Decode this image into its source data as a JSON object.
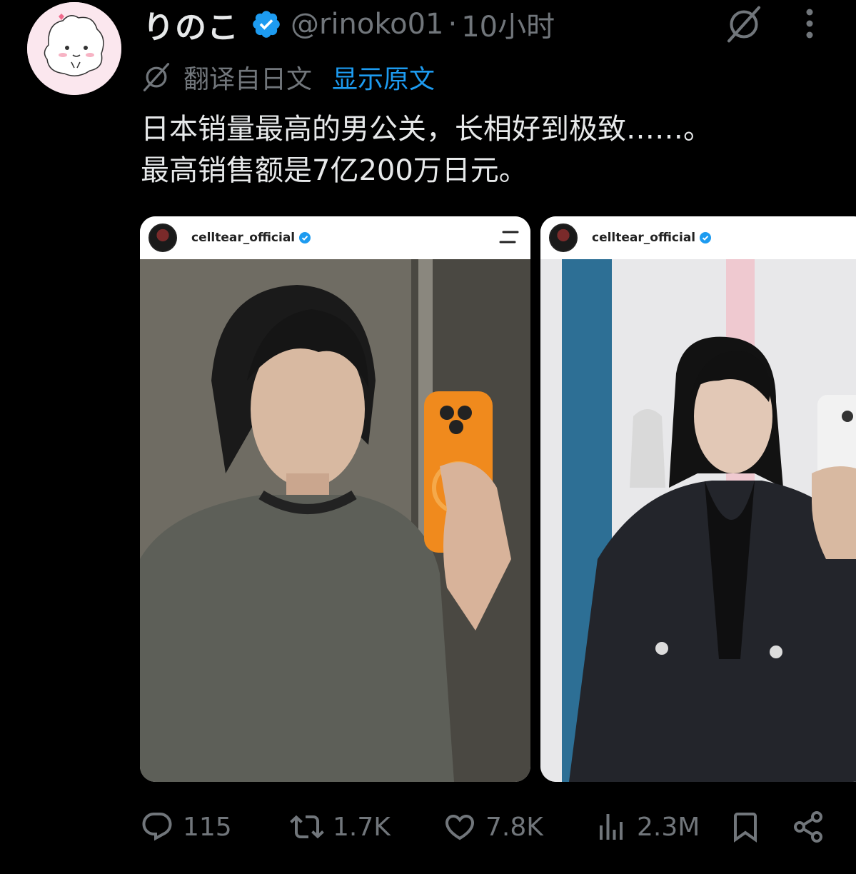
{
  "tweet": {
    "display_name": "りのこ",
    "handle": "@rinoko01",
    "separator": "·",
    "time": "10小时",
    "translated_label": "翻译自日文",
    "show_original": "显示原文",
    "text_lines": [
      "日本销量最高的男公关，长相好到极致……。",
      "最高销售额是7亿200万日元。"
    ]
  },
  "media": [
    {
      "account": "celltear_official"
    },
    {
      "account": "celltear_official"
    }
  ],
  "actions": {
    "replies": "115",
    "reposts": "1.7K",
    "likes": "7.8K",
    "views": "2.3M"
  },
  "colors": {
    "background": "#000000",
    "text": "#e7e9ea",
    "secondary": "#71767b",
    "link": "#1d9bf0",
    "verified": "#1d9bf0"
  },
  "icons": [
    "verified-badge-icon",
    "grok-icon",
    "more-icon",
    "translate-icon",
    "reply-icon",
    "repost-icon",
    "like-icon",
    "views-icon",
    "bookmark-icon",
    "share-icon"
  ]
}
